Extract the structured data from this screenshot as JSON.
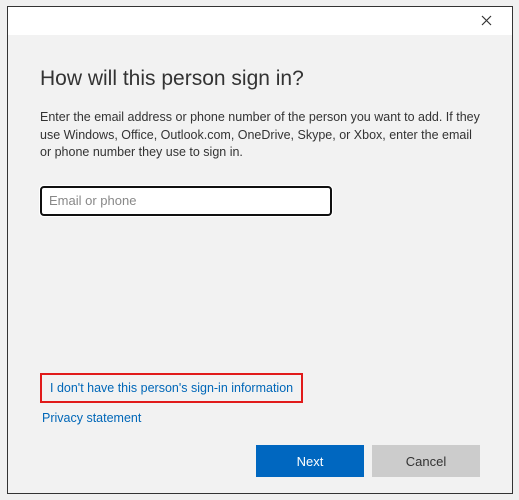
{
  "dialog": {
    "heading": "How will this person sign in?",
    "description": "Enter the email address or phone number of the person you want to add. If they use Windows, Office, Outlook.com, OneDrive, Skype, or Xbox, enter the email or phone number they use to sign in.",
    "input": {
      "placeholder": "Email or phone",
      "value": ""
    },
    "links": {
      "no_signin_info": "I don't have this person's sign-in information",
      "privacy": "Privacy statement"
    },
    "buttons": {
      "next": "Next",
      "cancel": "Cancel"
    }
  }
}
